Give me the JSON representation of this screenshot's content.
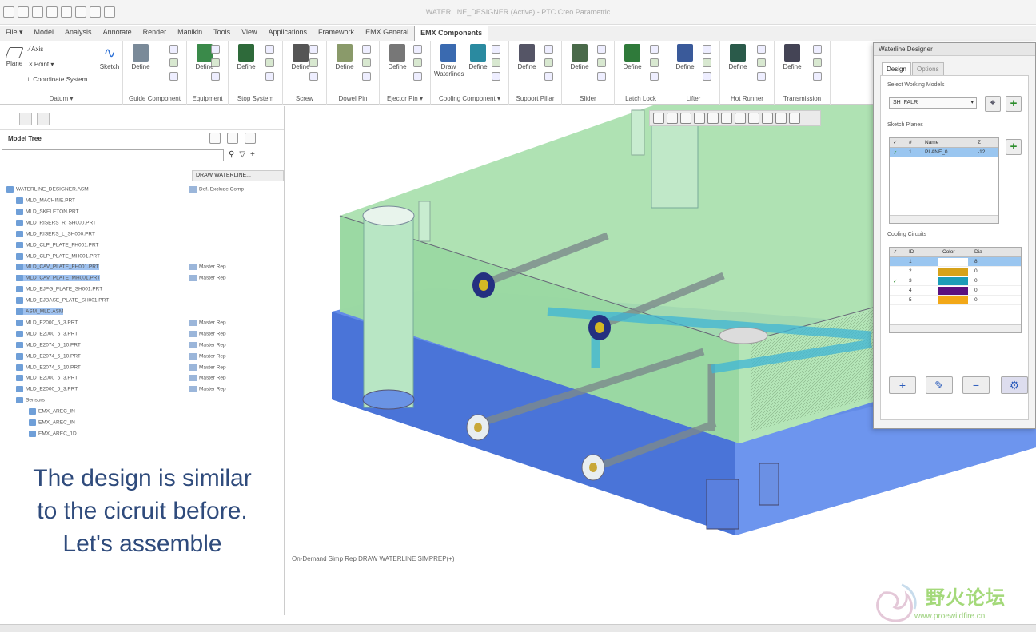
{
  "window": {
    "title": "WATERLINE_DESIGNER (Active) - PTC Creo Parametric"
  },
  "menu": {
    "tabs": [
      "File ▾",
      "Model",
      "Analysis",
      "Annotate",
      "Render",
      "Manikin",
      "Tools",
      "View",
      "Applications",
      "Framework",
      "EMX General",
      "EMX Components"
    ],
    "active_index": 11
  },
  "ribbon": {
    "datum": {
      "plane": "Plane",
      "axis": "Axis",
      "point": "Point ▾",
      "coord": "Coordinate System",
      "sketch": "Sketch",
      "label": "Datum ▾"
    },
    "groups": [
      {
        "label": "Guide Component",
        "btn": "Define"
      },
      {
        "label": "Equipment",
        "btn": "Define"
      },
      {
        "label": "Stop System",
        "btn": "Define"
      },
      {
        "label": "Screw",
        "btn": "Define"
      },
      {
        "label": "Dowel Pin",
        "btn": "Define"
      },
      {
        "label": "Ejector Pin ▾",
        "btn": "Define"
      },
      {
        "label": "Cooling Component ▾",
        "btn": "Draw Waterlines",
        "btn2": "Define"
      },
      {
        "label": "Support Pillar",
        "btn": "Define"
      },
      {
        "label": "Slider",
        "btn": "Define"
      },
      {
        "label": "Latch Lock",
        "btn": "Define"
      },
      {
        "label": "Lifter",
        "btn": "Define"
      },
      {
        "label": "Hot Runner",
        "btn": "Define"
      },
      {
        "label": "Transmission",
        "btn": "Define"
      }
    ]
  },
  "model_tree": {
    "title": "Model Tree",
    "column": "DRAW WATERLINE...",
    "root": "WATERLINE_DESIGNER.ASM",
    "root_rep": "Def. Exclude Comp",
    "items": [
      {
        "name": "MLD_MACHINE.PRT",
        "rep": ""
      },
      {
        "name": "MLD_SKELETON.PRT",
        "rep": ""
      },
      {
        "name": "MLD_RISERS_R_SH000.PRT",
        "rep": ""
      },
      {
        "name": "MLD_RISERS_L_SH000.PRT",
        "rep": ""
      },
      {
        "name": "MLD_CLP_PLATE_FH001.PRT",
        "rep": ""
      },
      {
        "name": "MLD_CLP_PLATE_MH001.PRT",
        "rep": ""
      },
      {
        "name": "MLD_CAV_PLATE_FH001.PRT",
        "rep": "Master Rep",
        "sel": true
      },
      {
        "name": "MLD_CAV_PLATE_MH001.PRT",
        "rep": "Master Rep",
        "sel": true
      },
      {
        "name": "MLD_EJPG_PLATE_SH001.PRT",
        "rep": ""
      },
      {
        "name": "MLD_EJBASE_PLATE_SH001.PRT",
        "rep": ""
      },
      {
        "name": "ASM_MLD.ASM",
        "rep": "",
        "sel": true
      },
      {
        "name": "MLD_E2000_5_3.PRT",
        "rep": "Master Rep"
      },
      {
        "name": "MLD_E2000_5_3.PRT",
        "rep": "Master Rep"
      },
      {
        "name": "MLD_E2074_5_10.PRT",
        "rep": "Master Rep"
      },
      {
        "name": "MLD_E2074_5_10.PRT",
        "rep": "Master Rep"
      },
      {
        "name": "MLD_E2074_5_10.PRT",
        "rep": "Master Rep"
      },
      {
        "name": "MLD_E2000_5_3.PRT",
        "rep": "Master Rep"
      },
      {
        "name": "MLD_E2000_5_3.PRT",
        "rep": "Master Rep"
      },
      {
        "name": "Sensors",
        "rep": ""
      },
      {
        "name": "EMX_AREC_IN",
        "rep": ""
      },
      {
        "name": "EMX_AREC_IN",
        "rep": ""
      },
      {
        "name": "EMX_AREC_1D",
        "rep": ""
      }
    ]
  },
  "caption": {
    "line1": "The design is similar",
    "line2": "to the cicruit before.",
    "line3": "Let's assemble"
  },
  "status": {
    "message": "On-Demand Simp Rep DRAW WATERLINE SIMPREP(+)"
  },
  "dialog": {
    "title": "Waterline Designer",
    "tabs": [
      "Design",
      "Options"
    ],
    "working_models_label": "Select Working Models",
    "working_model_value": "SH_FALR",
    "sketch_planes_label": "Sketch Planes",
    "sketch_headers": [
      "#",
      "Name",
      "Z"
    ],
    "sketch_rows": [
      {
        "n": "1",
        "name": "PLANE_0",
        "z": "-12"
      }
    ],
    "circuits_label": "Cooling Circuits",
    "circuit_headers": [
      "ID",
      "Color",
      "Dia"
    ],
    "circuits": [
      {
        "id": "1",
        "color": "#ffffff",
        "dia": "8"
      },
      {
        "id": "2",
        "color": "#d6a21a",
        "dia": "0"
      },
      {
        "id": "3",
        "color": "#1b9cb8",
        "dia": "0"
      },
      {
        "id": "4",
        "color": "#5a1080",
        "dia": "0"
      },
      {
        "id": "5",
        "color": "#f2a818",
        "dia": "0"
      }
    ]
  },
  "watermark": {
    "title": "野火论坛",
    "url": "www.proewildfire.cn"
  }
}
